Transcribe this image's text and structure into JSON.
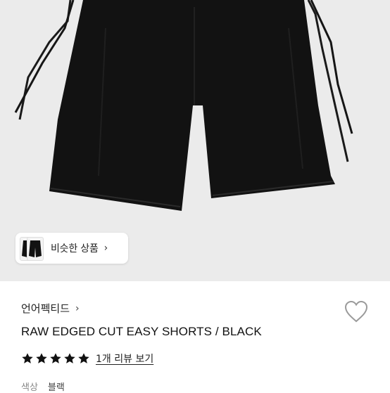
{
  "hero": {
    "image": "black-shorts-product-photo",
    "background": "#ebebeb"
  },
  "similar": {
    "label": "비슷한 상품",
    "chevron": "›"
  },
  "product": {
    "brand": "언어펙티드",
    "brand_chevron": "›",
    "title": "RAW EDGED CUT EASY SHORTS / BLACK",
    "rating_stars": 5,
    "review_link": "1개 리뷰 보기",
    "color_label": "색상",
    "color_value": "블랙"
  },
  "colors": {
    "garment": "#121212",
    "star": "#111111"
  }
}
